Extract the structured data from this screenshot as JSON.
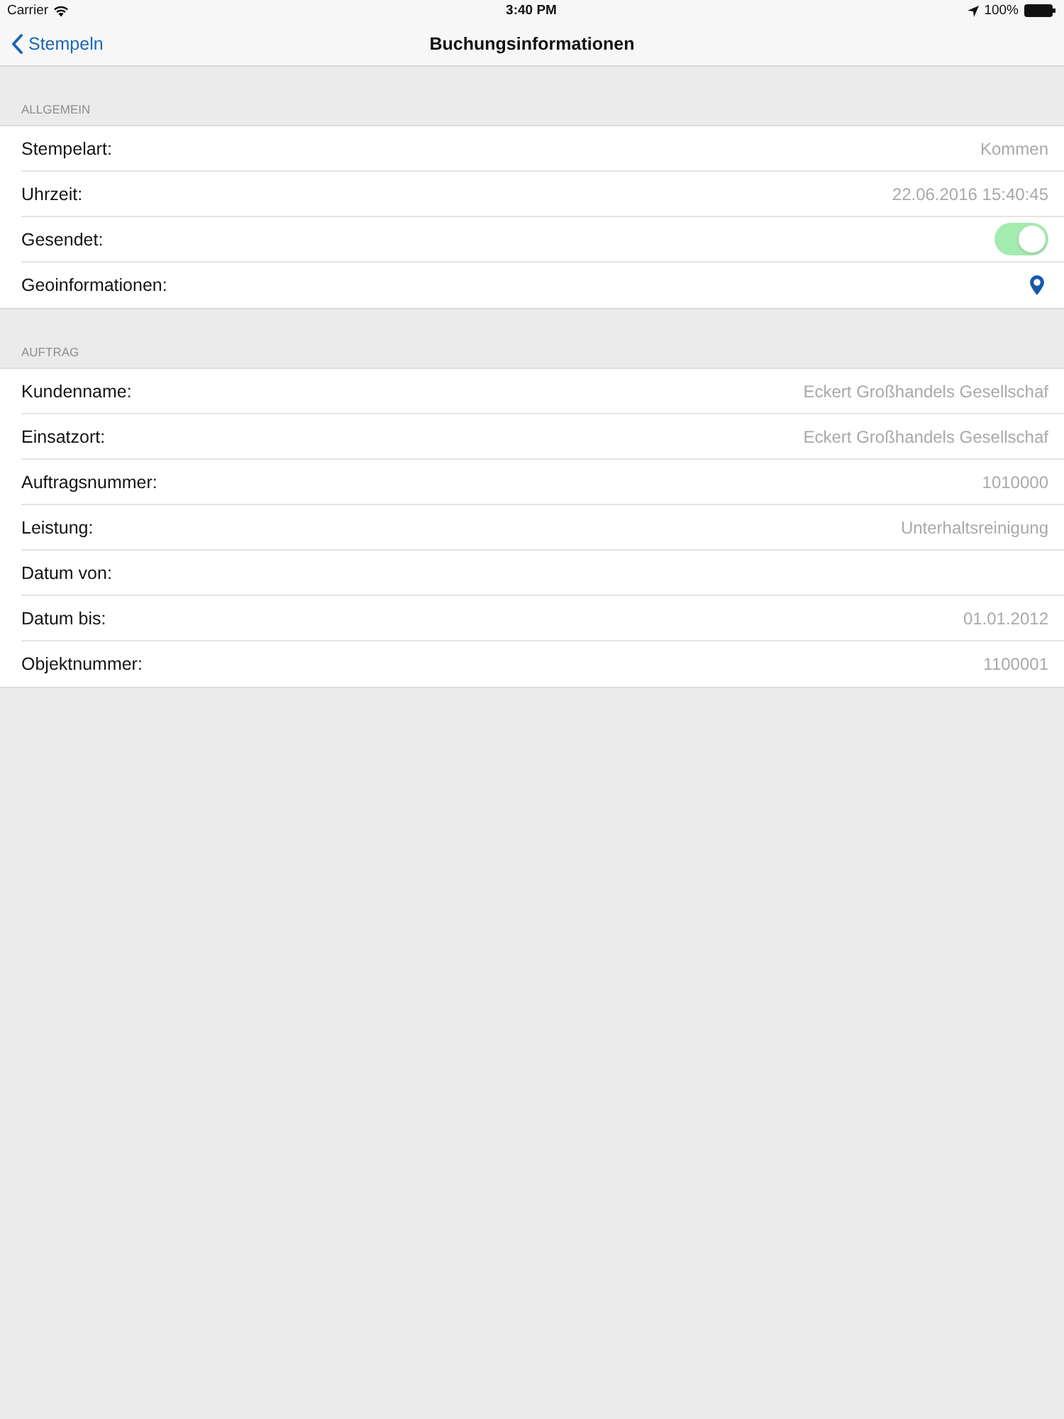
{
  "status_bar": {
    "carrier": "Carrier",
    "time": "3:40 PM",
    "battery": "100%"
  },
  "nav_bar": {
    "back": "Stempeln",
    "title": "Buchungsinformationen"
  },
  "sections": [
    {
      "header": "ALLGEMEIN",
      "rows": [
        {
          "kind": "text",
          "label": "Stempelart:",
          "value": "Kommen"
        },
        {
          "kind": "text",
          "label": "Uhrzeit:",
          "value": "22.06.2016 15:40:45"
        },
        {
          "kind": "toggle",
          "label": "Gesendet:",
          "on": true,
          "disabled": true
        },
        {
          "kind": "location",
          "label": "Geoinformationen:"
        }
      ]
    },
    {
      "header": "AUFTRAG",
      "rows": [
        {
          "kind": "text",
          "label": "Kundenname:",
          "value": "Eckert Großhandels Gesellschaf"
        },
        {
          "kind": "text",
          "label": "Einsatzort:",
          "value": "Eckert Großhandels Gesellschaf"
        },
        {
          "kind": "text",
          "label": "Auftragsnummer:",
          "value": "1010000"
        },
        {
          "kind": "text",
          "label": "Leistung:",
          "value": "Unterhaltsreinigung"
        },
        {
          "kind": "text",
          "label": "Datum von:"
        },
        {
          "kind": "text",
          "label": "Datum bis:",
          "value": "01.01.2012"
        },
        {
          "kind": "text",
          "label": "Objektnummer:",
          "value": "1100001"
        }
      ]
    }
  ]
}
